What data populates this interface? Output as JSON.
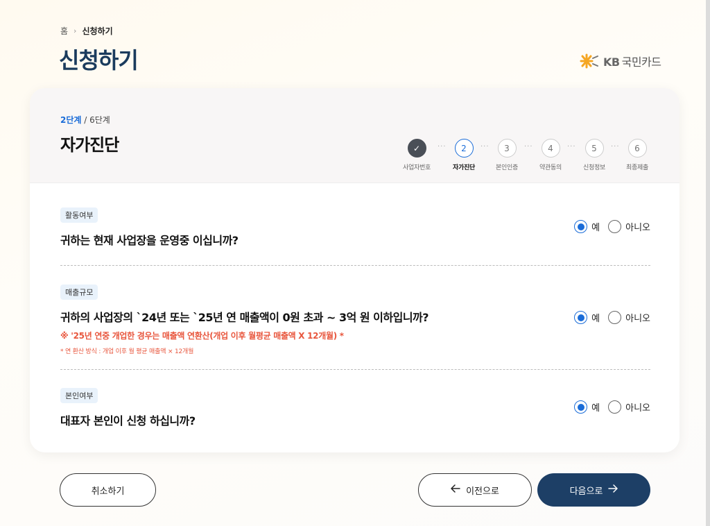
{
  "breadcrumb": {
    "home": "홈",
    "separator": "›",
    "current": "신청하기"
  },
  "page_title": "신청하기",
  "logo": {
    "brand": "KB",
    "name": "국민카드"
  },
  "step_info": {
    "current": "2단계",
    "separator": " / ",
    "total": "6단계",
    "title": "자가진단"
  },
  "steps": [
    {
      "num": "✓",
      "label": "사업자번호",
      "state": "done"
    },
    {
      "num": "2",
      "label": "자가진단",
      "state": "active"
    },
    {
      "num": "3",
      "label": "본인인증",
      "state": "pending"
    },
    {
      "num": "4",
      "label": "약관동의",
      "state": "pending"
    },
    {
      "num": "5",
      "label": "신청정보",
      "state": "pending"
    },
    {
      "num": "6",
      "label": "최종제출",
      "state": "pending"
    }
  ],
  "step_dots": "···",
  "questions": [
    {
      "badge": "활동여부",
      "text": "귀하는 현재 사업장을 운영중 이십니까?",
      "yes": "예",
      "no": "아니오",
      "selected": "yes"
    },
    {
      "badge": "매출규모",
      "text": "귀하의 사업장의 `24년 또는 `25년 연 매출액이 0원 초과 ~ 3억 원 이하입니까?",
      "note1": "※ '25년 연중 개업한 경우는 매출액 연환산(개업 이후 월평균 매출액 X 12개월) *",
      "note2": "* 연 환산 방식 : 개업 이후 월 평균 매출액 × 12개월",
      "yes": "예",
      "no": "아니오",
      "selected": "yes"
    },
    {
      "badge": "본인여부",
      "text": "대표자 본인이 신청 하십니까?",
      "yes": "예",
      "no": "아니오",
      "selected": "yes"
    }
  ],
  "buttons": {
    "cancel": "취소하기",
    "prev": "이전으로",
    "next": "다음으로"
  },
  "colors": {
    "title": "#1a3b5d",
    "accent": "#1a6cd8",
    "primary_button": "#1d3f66",
    "warning": "#e8563d",
    "logo_mark": "#f5a623"
  }
}
